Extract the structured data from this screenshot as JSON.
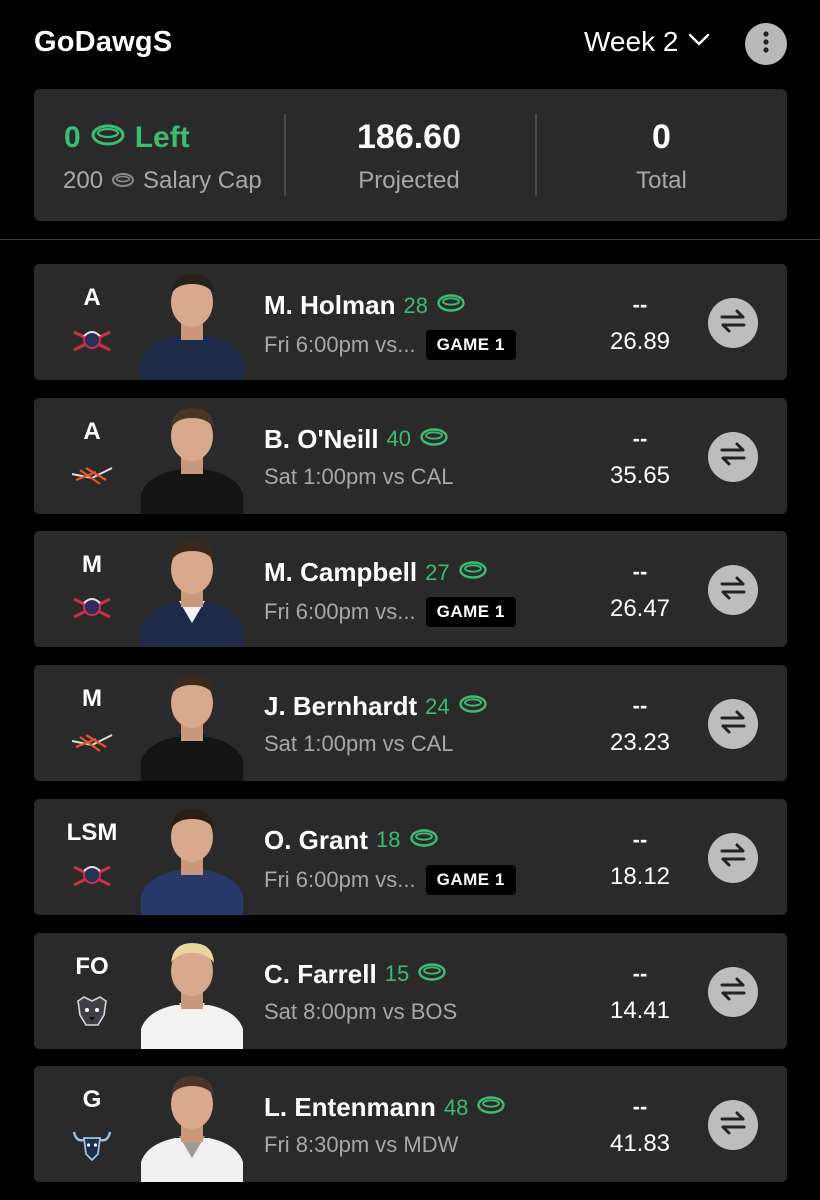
{
  "header": {
    "team_name": "GoDawgS",
    "week_label": "Week 2"
  },
  "summary": {
    "left_value": "0",
    "left_label": "Left",
    "salary_cap_value": "200",
    "salary_cap_label": "Salary Cap",
    "projected_value": "186.60",
    "projected_label": "Projected",
    "total_value": "0",
    "total_label": "Total"
  },
  "colors": {
    "accent_green": "#3bbd74",
    "card_bg": "#2a2a2b",
    "muted_text": "#a8a8a8"
  },
  "roster": [
    {
      "position": "A",
      "team_logo": "shield-logo-icon",
      "name": "M. Holman",
      "salary": "28",
      "game": "Fri 6:00pm vs...",
      "badge": "GAME 1",
      "actual": "--",
      "projected": "26.89"
    },
    {
      "position": "A",
      "team_logo": "wings-logo-icon",
      "name": "B. O'Neill",
      "salary": "40",
      "game": "Sat 1:00pm vs CAL",
      "badge": "",
      "actual": "--",
      "projected": "35.65"
    },
    {
      "position": "M",
      "team_logo": "shield-logo-icon",
      "name": "M. Campbell",
      "salary": "27",
      "game": "Fri 6:00pm vs...",
      "badge": "GAME 1",
      "actual": "--",
      "projected": "26.47"
    },
    {
      "position": "M",
      "team_logo": "wings-logo-icon",
      "name": "J. Bernhardt",
      "salary": "24",
      "game": "Sat 1:00pm vs CAL",
      "badge": "",
      "actual": "--",
      "projected": "23.23"
    },
    {
      "position": "LSM",
      "team_logo": "shield-logo-icon",
      "name": "O. Grant",
      "salary": "18",
      "game": "Fri 6:00pm vs...",
      "badge": "GAME 1",
      "actual": "--",
      "projected": "18.12"
    },
    {
      "position": "FO",
      "team_logo": "dog-logo-icon",
      "name": "C. Farrell",
      "salary": "15",
      "game": "Sat 8:00pm vs BOS",
      "badge": "",
      "actual": "--",
      "projected": "14.41"
    },
    {
      "position": "G",
      "team_logo": "bull-logo-icon",
      "name": "L. Entenmann",
      "salary": "48",
      "game": "Fri 8:30pm vs MDW",
      "badge": "",
      "actual": "--",
      "projected": "41.83"
    }
  ]
}
